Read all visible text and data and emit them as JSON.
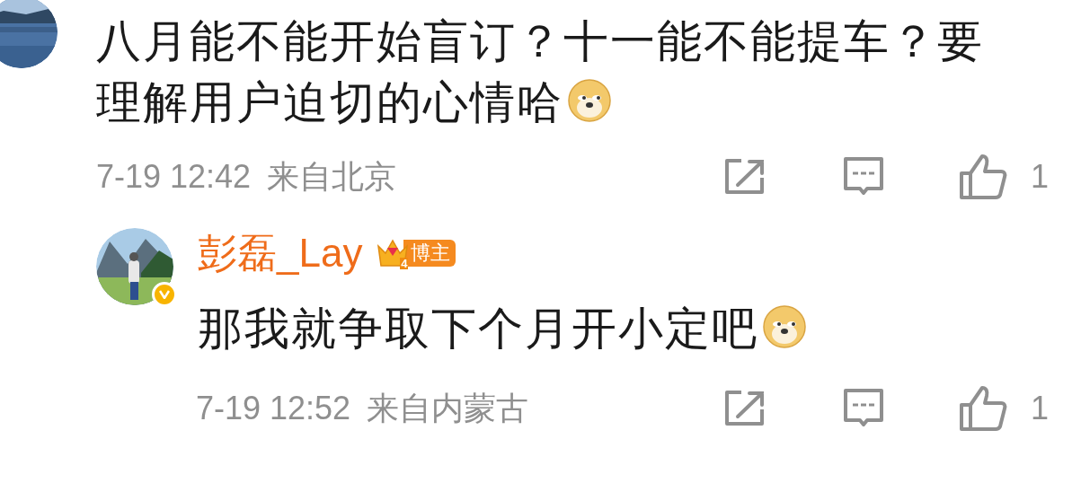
{
  "comment": {
    "text": "八月能不能开始盲订？十一能不能提车？要理解用户迫切的心情哈",
    "time": "7-19 12:42",
    "location": "来自北京",
    "likes": "1"
  },
  "reply": {
    "author": "彭磊_Lay",
    "level": "4",
    "badge": "博主",
    "verified": true,
    "text": "那我就争取下个月开小定吧",
    "time": "7-19 12:52",
    "location": "来自内蒙古",
    "likes": "1"
  }
}
